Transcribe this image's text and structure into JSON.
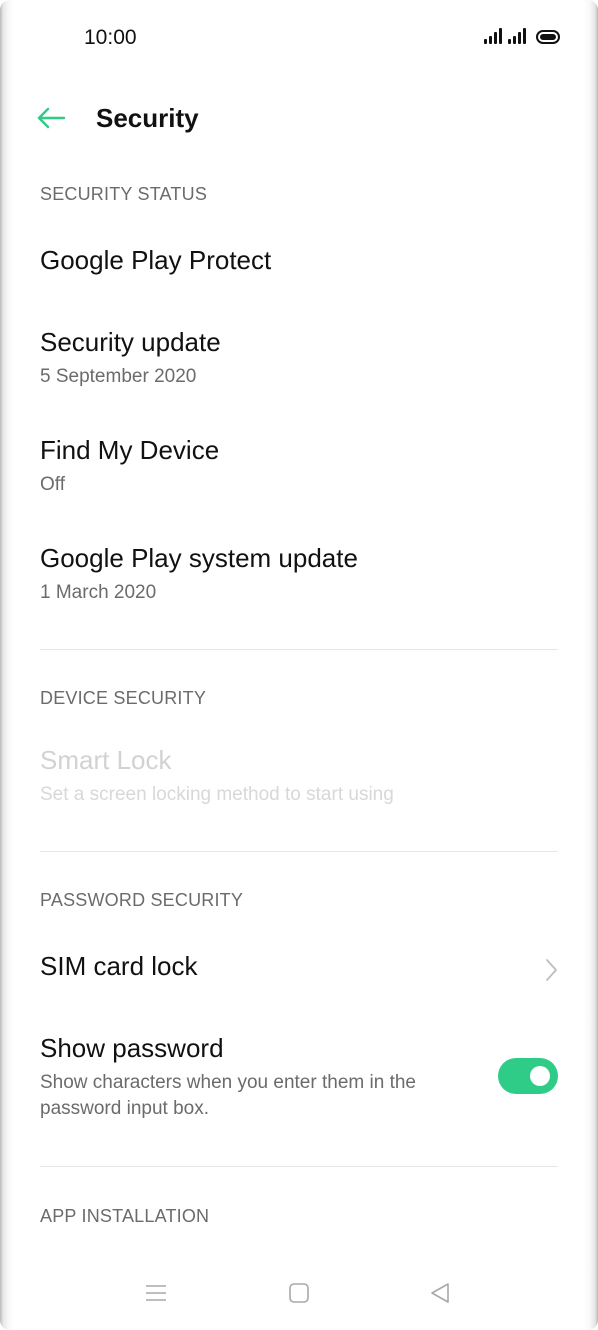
{
  "status_bar": {
    "time": "10:00",
    "icons": [
      "signal-1-icon",
      "signal-2-icon",
      "battery-icon"
    ]
  },
  "header": {
    "title": "Security",
    "back_icon": "arrow-left-icon"
  },
  "colors": {
    "accent": "#2ECC86",
    "text_primary": "#111111",
    "text_secondary": "#6B6B6B",
    "text_disabled": "#D2D2D2",
    "divider": "#E6E6E6"
  },
  "sections": {
    "security_status": {
      "header": "SECURITY STATUS",
      "items": [
        {
          "title": "Google Play Protect",
          "subtitle": ""
        },
        {
          "title": "Security update",
          "subtitle": "5 September 2020"
        },
        {
          "title": "Find My Device",
          "subtitle": "Off"
        },
        {
          "title": "Google Play system update",
          "subtitle": "1 March 2020"
        }
      ]
    },
    "device_security": {
      "header": "DEVICE SECURITY",
      "items": [
        {
          "title": "Smart Lock",
          "subtitle": "Set a screen locking method to start using",
          "disabled": true
        }
      ]
    },
    "password_security": {
      "header": "PASSWORD SECURITY",
      "items": [
        {
          "title": "SIM card lock",
          "subtitle": "",
          "trailing_icon": "chevron-right-icon"
        },
        {
          "title": "Show password",
          "subtitle_line1": "Show characters when you enter them in the",
          "subtitle_line2": "password input box.",
          "toggle": "on"
        }
      ]
    },
    "app_installation": {
      "header": "APP INSTALLATION"
    }
  },
  "nav_bar": {
    "icons": [
      "menu-icon",
      "home-icon",
      "back-triangle-icon"
    ]
  }
}
